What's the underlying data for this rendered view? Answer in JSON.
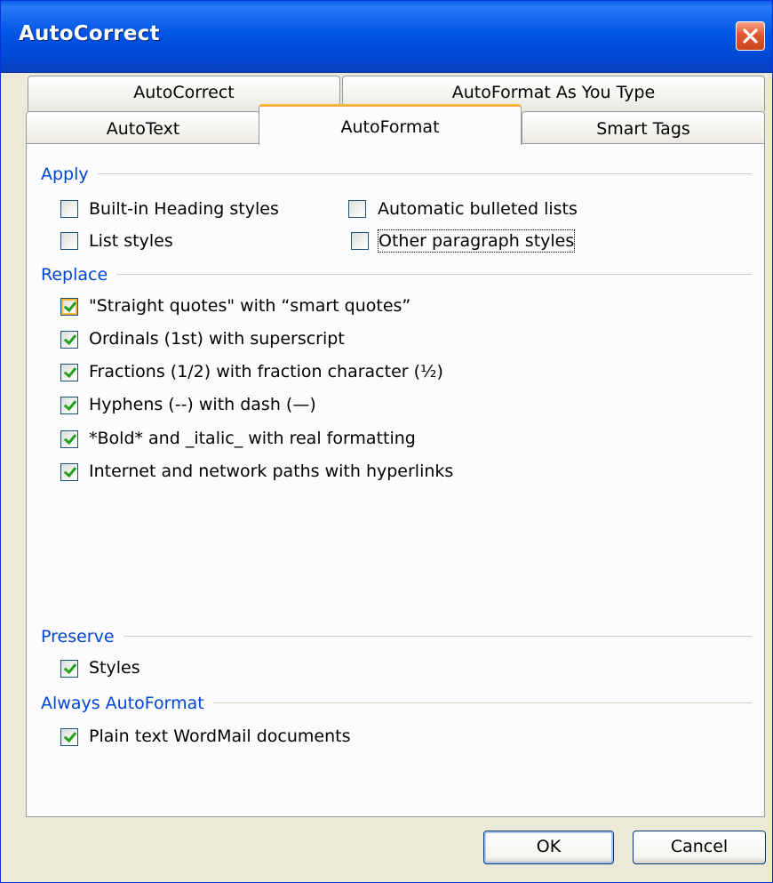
{
  "window": {
    "title": "AutoCorrect"
  },
  "tabs": {
    "row_back": [
      "AutoCorrect",
      "AutoFormat As You Type"
    ],
    "row_front": [
      "AutoText",
      "AutoFormat",
      "Smart Tags"
    ],
    "active": "AutoFormat"
  },
  "sections": {
    "apply": {
      "title": "Apply",
      "items": [
        {
          "label": "Built-in Heading styles",
          "checked": false
        },
        {
          "label": "Automatic bulleted lists",
          "checked": false
        },
        {
          "label": "List styles",
          "checked": false
        },
        {
          "label": "Other paragraph styles",
          "checked": false
        }
      ]
    },
    "replace": {
      "title": "Replace",
      "items": [
        {
          "label": "\"Straight quotes\" with “smart quotes”",
          "checked": true
        },
        {
          "label": "Ordinals (1st) with superscript",
          "checked": true
        },
        {
          "label": "Fractions (1/2) with fraction character (½)",
          "checked": true
        },
        {
          "label": "Hyphens (--) with dash (—)",
          "checked": true
        },
        {
          "label": "*Bold* and _italic_ with real formatting",
          "checked": true
        },
        {
          "label": "Internet and network paths with hyperlinks",
          "checked": true
        }
      ]
    },
    "preserve": {
      "title": "Preserve",
      "items": [
        {
          "label": "Styles",
          "checked": true
        }
      ]
    },
    "always": {
      "title": "Always AutoFormat",
      "items": [
        {
          "label": "Plain text WordMail documents",
          "checked": true
        }
      ]
    }
  },
  "buttons": {
    "ok": "OK",
    "cancel": "Cancel"
  },
  "icons": {
    "close": "close-icon"
  },
  "colors": {
    "accent": "#0046D5",
    "title_bar": "#0055E5",
    "active_tab": "#F5B441"
  }
}
